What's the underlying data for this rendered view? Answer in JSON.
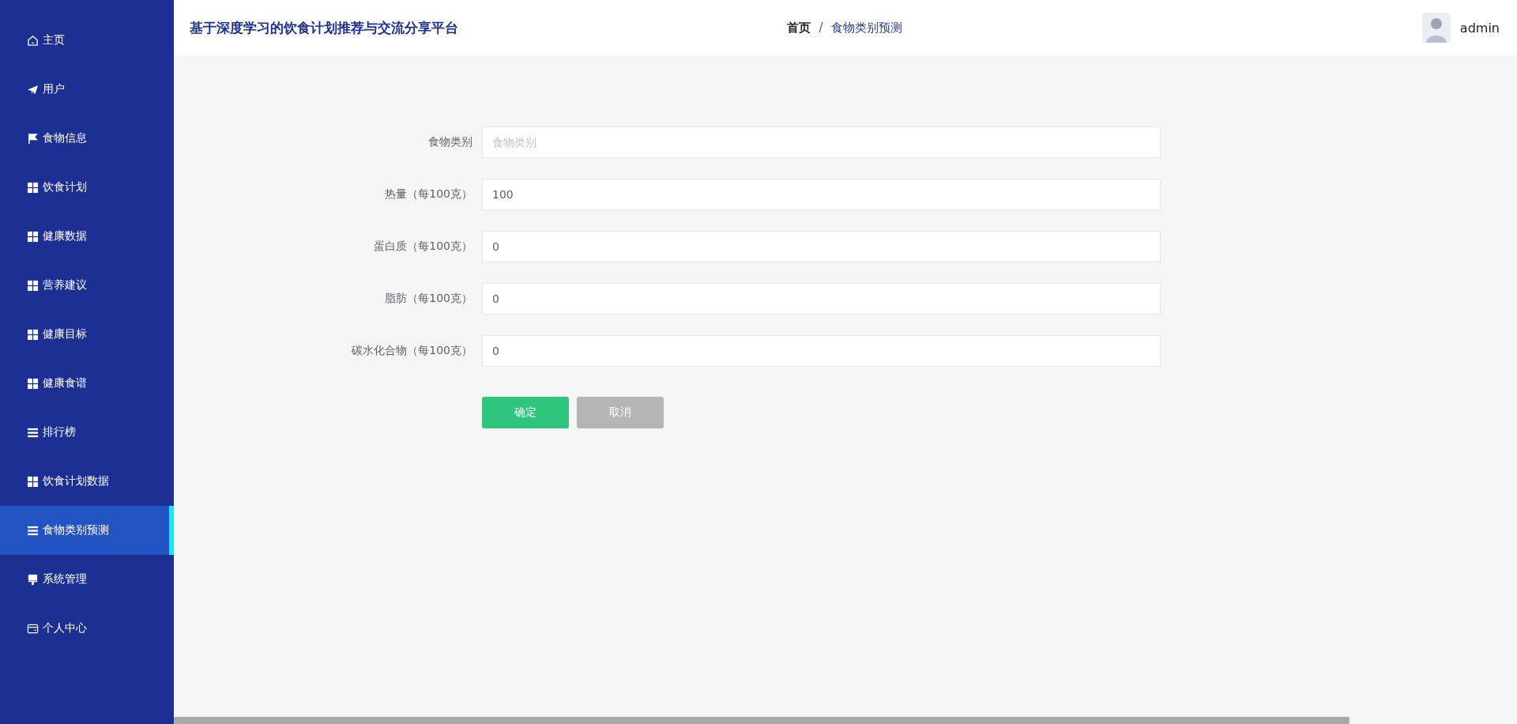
{
  "sidebar": {
    "items": [
      {
        "label": "主页",
        "selected": false
      },
      {
        "label": "用户",
        "selected": false
      },
      {
        "label": "食物信息",
        "selected": false
      },
      {
        "label": "饮食计划",
        "selected": false
      },
      {
        "label": "健康数据",
        "selected": false
      },
      {
        "label": "营养建议",
        "selected": false
      },
      {
        "label": "健康目标",
        "selected": false
      },
      {
        "label": "健康食谱",
        "selected": false
      },
      {
        "label": "排行榜",
        "selected": false
      },
      {
        "label": "饮食计划数据",
        "selected": false
      },
      {
        "label": "食物类别预测",
        "selected": true
      },
      {
        "label": "系统管理",
        "selected": false
      },
      {
        "label": "个人中心",
        "selected": false
      }
    ]
  },
  "header": {
    "title": "基于深度学习的饮食计划推荐与交流分享平台",
    "breadcrumb": [
      "首页",
      "食物类别预测"
    ],
    "separator": "/",
    "user": "admin"
  },
  "form": {
    "fields": [
      {
        "label": "食物类别",
        "placeholder": "食物类别"
      },
      {
        "label": "热量（每100克）",
        "value": "100"
      },
      {
        "label": "蛋白质（每100克）",
        "value": "0"
      },
      {
        "label": "脂肪（每100克）",
        "value": "0"
      },
      {
        "label": "碳水化合物（每100克）",
        "value": "0"
      }
    ],
    "buttons": [
      {
        "label": "确定",
        "kind": "primary"
      },
      {
        "label": "取消",
        "kind": "secondary"
      }
    ]
  }
}
